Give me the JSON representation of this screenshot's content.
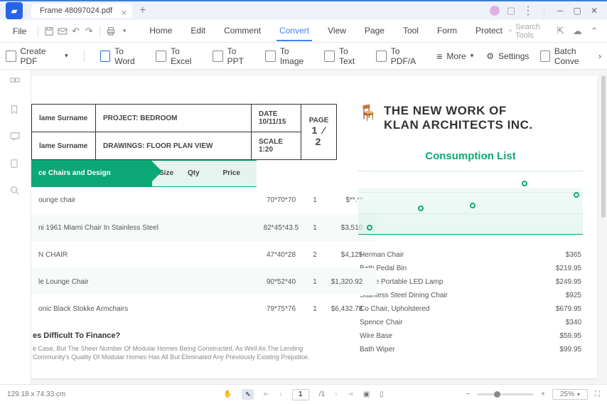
{
  "titlebar": {
    "filename": "Frame 48097024.pdf"
  },
  "menubar": {
    "file": "File",
    "tabs": [
      "Home",
      "Edit",
      "Comment",
      "Convert",
      "View",
      "Page",
      "Tool",
      "Form",
      "Protect"
    ],
    "active_tab": "Convert",
    "search_placeholder": "Search Tools"
  },
  "toolbar": {
    "items": [
      "Create PDF",
      "To Word",
      "To Excel",
      "To PPT",
      "To Image",
      "To Text",
      "To PDF/A",
      "More"
    ],
    "settings": "Settings",
    "batch": "Batch Conve"
  },
  "doc": {
    "header": {
      "name_label": "lame Surname",
      "project": "PROJECT: BEDROOM",
      "date": "DATE 10/11/15",
      "drawings": "DRAWINGS: FLOOR PLAN VIEW",
      "scale": "SCALE 1:20",
      "page_label": "PAGE",
      "page_frac": "1 ⁄ 2"
    },
    "table": {
      "cols": [
        "ce Chairs and Design",
        "Size",
        "Qty",
        "Price"
      ],
      "rows": [
        {
          "name": "ounge chair",
          "size": "70*70*70",
          "qty": "1",
          "price": "$**.**"
        },
        {
          "name": "ni 1961 Miami Chair In Stainless Steel",
          "size": "82*45*43.5",
          "qty": "1",
          "price": "$3,510"
        },
        {
          "name": "N CHAIR",
          "size": "47*40*28",
          "qty": "2",
          "price": "$4,125"
        },
        {
          "name": "le Lounge Chair",
          "size": "90*52*40",
          "qty": "1",
          "price": "$1,320.92"
        },
        {
          "name": "onic Black Stokke Armchairs",
          "size": "79*75*76",
          "qty": "1",
          "price": "$6,432.78"
        }
      ]
    },
    "note": {
      "heading": "es Difficult To Finance?",
      "body": "e Case, But The Sheer Number Of Modular Homes Being Constructed, As Well As The Lending Community's Quality Of Modular Homes Has All But Eliminated Any Previously Existing Prejudice."
    },
    "brand": {
      "title_l1": "THE NEW WORK OF",
      "title_l2": "KLAN ARCHITECTS INC.",
      "subtitle": "Consumption List"
    },
    "consumption": [
      {
        "item": "Herman Chair",
        "amt": "$365"
      },
      {
        "item": "Bath Pedal Bin",
        "amt": "$219.95"
      },
      {
        "item": "Carrie Portable LED Lamp",
        "amt": "$249.95"
      },
      {
        "item": "Stainless Steel Dining Chair",
        "amt": "$925"
      },
      {
        "item": "Co Chair, Upholstered",
        "amt": "$679.95"
      },
      {
        "item": "Spence Chair",
        "amt": "$340"
      },
      {
        "item": "Wire Base",
        "amt": "$59.95"
      },
      {
        "item": "Bath Wiper",
        "amt": "$99.95"
      }
    ]
  },
  "chart_data": {
    "type": "line",
    "x": [
      0,
      1,
      2,
      3,
      4
    ],
    "values": [
      10,
      35,
      40,
      70,
      55
    ],
    "ylim": [
      0,
      100
    ]
  },
  "statusbar": {
    "dims": "129.18 x 74.33 cm",
    "page_current": "1",
    "page_total": "/1",
    "zoom": "25%"
  }
}
